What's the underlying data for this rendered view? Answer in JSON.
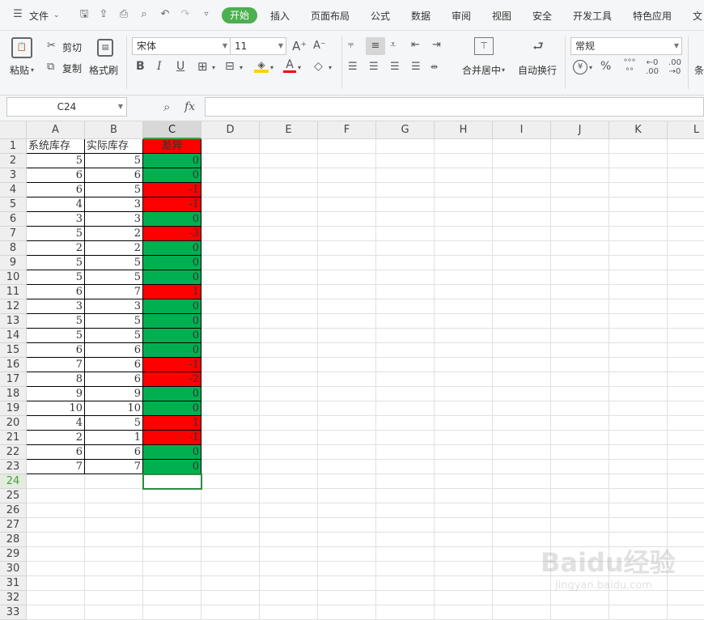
{
  "menu": {
    "file": "文件",
    "tabs": [
      "开始",
      "插入",
      "页面布局",
      "公式",
      "数据",
      "审阅",
      "视图",
      "安全",
      "开发工具",
      "特色应用",
      "文"
    ],
    "active_tab": "开始"
  },
  "ribbon": {
    "paste": "粘贴",
    "cut": "剪切",
    "copy": "复制",
    "format_painter": "格式刷",
    "font_name": "宋体",
    "font_size": "11",
    "merge_center": "合并居中",
    "wrap_text": "自动换行",
    "number_format": "常规",
    "percent": "%",
    "conditional": "条"
  },
  "formula_bar": {
    "name_box": "C24",
    "fx": "fx",
    "value": ""
  },
  "columns": [
    "A",
    "B",
    "C",
    "D",
    "E",
    "F",
    "G",
    "H",
    "I",
    "J",
    "K",
    "L"
  ],
  "selected_column": "C",
  "selected_row": 24,
  "row_count": 33,
  "headers": {
    "a": "系统库存",
    "b": "实际库存",
    "c": "差异"
  },
  "rows": [
    [
      5,
      5,
      0
    ],
    [
      6,
      6,
      0
    ],
    [
      6,
      5,
      -1
    ],
    [
      4,
      3,
      -1
    ],
    [
      3,
      3,
      0
    ],
    [
      5,
      2,
      -3
    ],
    [
      2,
      2,
      0
    ],
    [
      5,
      5,
      0
    ],
    [
      5,
      5,
      0
    ],
    [
      6,
      7,
      1
    ],
    [
      3,
      3,
      0
    ],
    [
      5,
      5,
      0
    ],
    [
      5,
      5,
      0
    ],
    [
      6,
      6,
      0
    ],
    [
      7,
      6,
      -1
    ],
    [
      8,
      6,
      -2
    ],
    [
      9,
      9,
      0
    ],
    [
      10,
      10,
      0
    ],
    [
      4,
      5,
      1
    ],
    [
      2,
      1,
      -1
    ],
    [
      6,
      6,
      0
    ],
    [
      7,
      7,
      0
    ]
  ],
  "colors": {
    "positive_or_negative": "#ff0000",
    "zero": "#00b050",
    "accent": "#4caf50"
  },
  "watermark": {
    "brand": "Baidu经验",
    "url": "jingyan.baidu.com"
  }
}
